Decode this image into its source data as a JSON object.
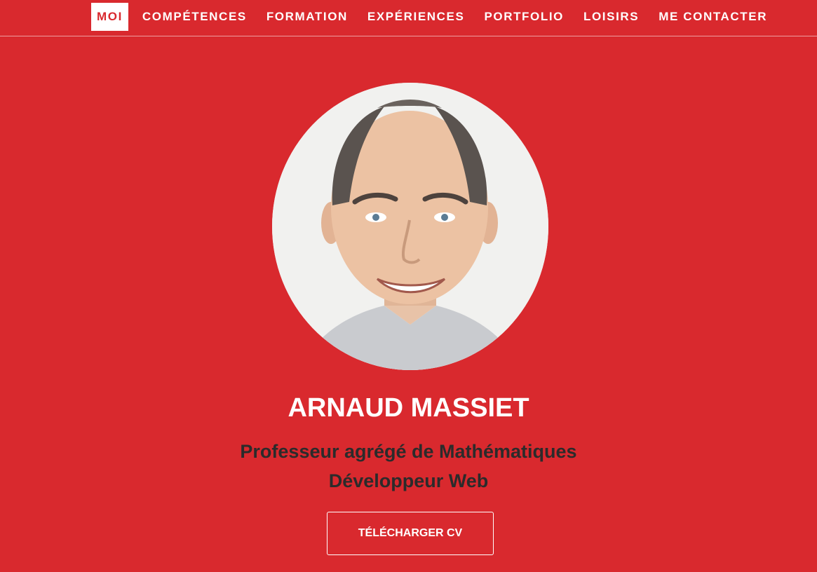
{
  "nav": {
    "items": [
      {
        "label": "MOI",
        "active": true
      },
      {
        "label": "COMPÉTENCES",
        "active": false
      },
      {
        "label": "FORMATION",
        "active": false
      },
      {
        "label": "EXPÉRIENCES",
        "active": false
      },
      {
        "label": "PORTFOLIO",
        "active": false
      },
      {
        "label": "LOISIRS",
        "active": false
      },
      {
        "label": "ME CONTACTER",
        "active": false
      }
    ]
  },
  "hero": {
    "name": "ARNAUD MASSIET",
    "subtitle_line1": "Professeur agrégé de Mathématiques",
    "subtitle_line2": "Développeur Web",
    "cv_button_label": "TÉLÉCHARGER CV",
    "photo_alt": "profile-photo"
  },
  "colors": {
    "accent": "#d9292e",
    "text_light": "#ffffff",
    "text_dark": "#2b2b2b"
  }
}
